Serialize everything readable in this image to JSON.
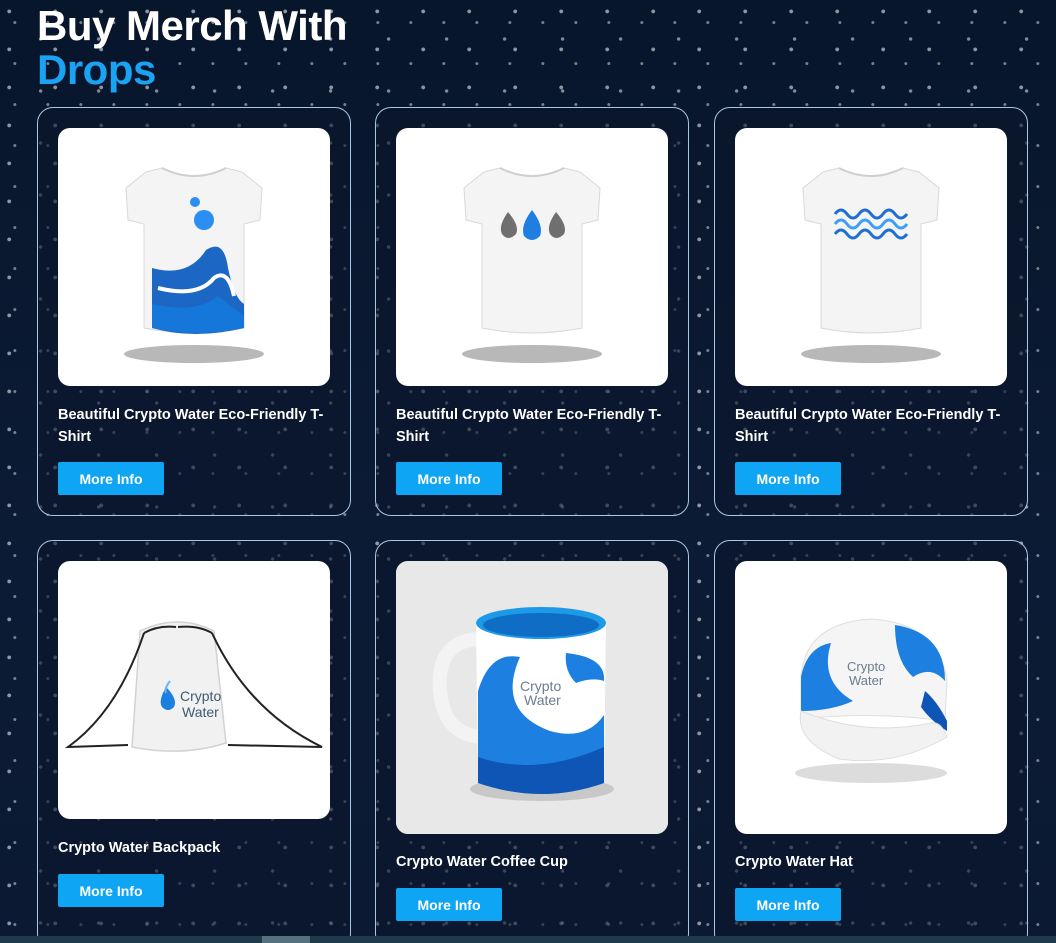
{
  "heading": {
    "line1": "Buy Merch With",
    "line2": "Drops"
  },
  "accent_color": "#1aa3f2",
  "button_color": "#0ea5f4",
  "products": [
    {
      "title": "Beautiful Crypto Water Eco-Friendly T-Shirt",
      "button": "More Info",
      "image": "tshirt-wave-icon"
    },
    {
      "title": "Beautiful Crypto Water Eco-Friendly T-Shirt",
      "button": "More Info",
      "image": "tshirt-drops-icon"
    },
    {
      "title": "Beautiful Crypto Water Eco-Friendly T-Shirt",
      "button": "More Info",
      "image": "tshirt-pattern-icon"
    },
    {
      "title": "Crypto Water Backpack",
      "button": "More Info",
      "image": "backpack-icon"
    },
    {
      "title": "Crypto Water Coffee Cup",
      "button": "More Info",
      "image": "mug-icon"
    },
    {
      "title": "Crypto Water Hat",
      "button": "More Info",
      "image": "cap-icon"
    }
  ],
  "brand": {
    "line1": "Crypto",
    "line2": "Water"
  }
}
